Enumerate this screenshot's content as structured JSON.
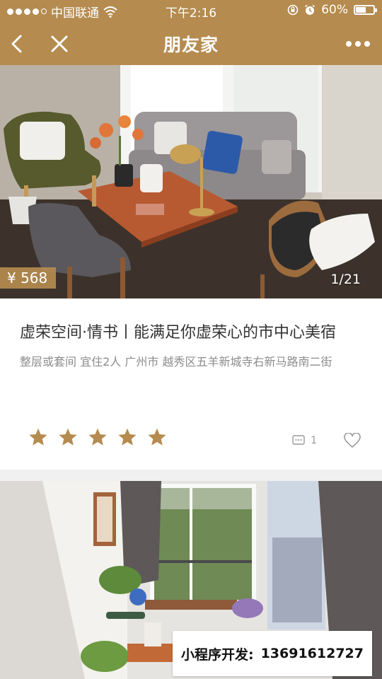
{
  "status_bar": {
    "carrier": "中国联通",
    "time": "下午2:16",
    "battery": "60%",
    "battery_level": 0.6
  },
  "nav": {
    "title": "朋友家",
    "icons": [
      "back-arrow-icon",
      "close-icon",
      "more-dots-icon"
    ]
  },
  "listings": [
    {
      "price": "¥ 568",
      "photo_counter": "1/21",
      "name": "虚荣空间·情书丨能满足你虚荣心的市中心美宿",
      "details": "整层或套间 宜住2人 广州市 越秀区五羊新城寺右新马路南二街",
      "rating_stars": 5,
      "comment_count": "1",
      "colors": {
        "accent": "#b58b4f",
        "star": "#b58b4f"
      }
    }
  ],
  "promo": {
    "label": "小程序开发:",
    "phone": "13691612727"
  },
  "colors": {
    "brand": "#b58b4f",
    "background": "#f0f0f0",
    "title_text": "#333333",
    "meta_text": "#8c8c8c"
  }
}
